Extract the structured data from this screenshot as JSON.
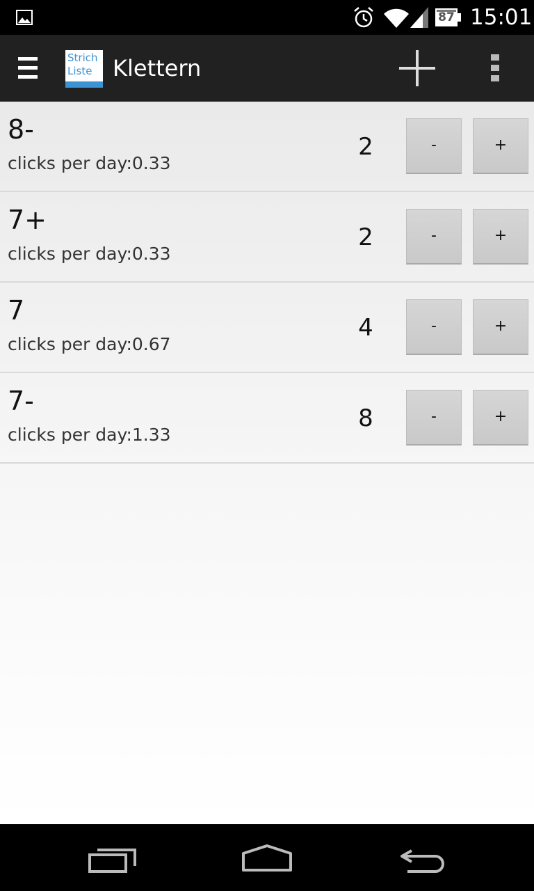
{
  "status_bar": {
    "time": "15:01",
    "battery_level": "87",
    "icons": [
      "gallery-icon",
      "alarm-icon",
      "wifi-icon",
      "signal-icon",
      "battery-icon"
    ]
  },
  "action_bar": {
    "logo_line_1": "Strich",
    "logo_line_2": "Liste",
    "title": "Klettern",
    "icons": [
      "drawer-icon",
      "add-icon",
      "overflow-menu-icon"
    ]
  },
  "counters": [
    {
      "name": "8-",
      "rate_label": "clicks per day:",
      "rate": "0.33",
      "count": "2",
      "minus_label": "-",
      "plus_label": "+"
    },
    {
      "name": "7+",
      "rate_label": "clicks per day:",
      "rate": "0.33",
      "count": "2",
      "minus_label": "-",
      "plus_label": "+"
    },
    {
      "name": "7",
      "rate_label": "clicks per day:",
      "rate": "0.67",
      "count": "4",
      "minus_label": "-",
      "plus_label": "+"
    },
    {
      "name": "7-",
      "rate_label": "clicks per day:",
      "rate": "1.33",
      "count": "8",
      "minus_label": "-",
      "plus_label": "+"
    }
  ],
  "nav_bar": {
    "icons": [
      "recents-icon",
      "home-icon",
      "back-icon"
    ]
  },
  "colors": {
    "action_bar": "#212121",
    "logo_accent": "#3b93d3",
    "button": "#cfcfcf",
    "divider": "#d9d9d9"
  }
}
